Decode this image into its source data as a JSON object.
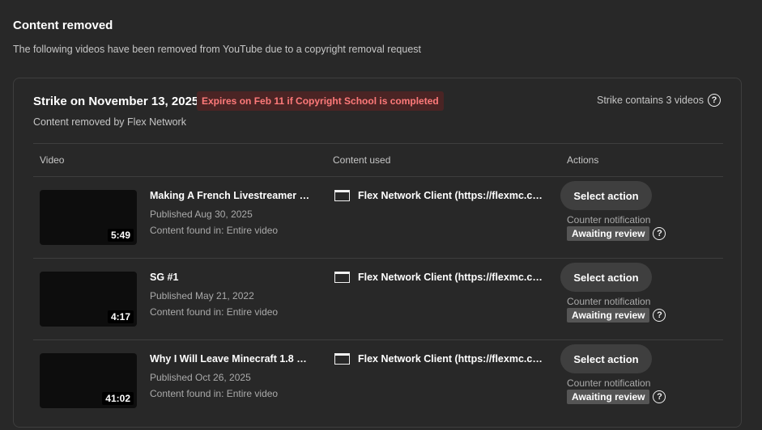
{
  "header": {
    "title": "Content removed",
    "description": "The following videos have been removed from YouTube due to a copyright removal request"
  },
  "strike": {
    "title": "Strike on November 13, 2025",
    "expires_badge": "Expires on Feb 11 if Copyright School is completed",
    "count_text": "Strike contains 3 videos",
    "removed_by": "Content removed by Flex Network"
  },
  "table": {
    "columns": [
      "Video",
      "Content used",
      "Actions"
    ],
    "rows": [
      {
        "title": "Making A French Livestreamer R...",
        "duration": "5:49",
        "published": "Published Aug 30, 2025",
        "found_in": "Content found in: Entire video",
        "content_used": "Flex Network Client (https://flexmc.co...",
        "action_label": "Select action",
        "counter_label": "Counter notification",
        "status": "Awaiting review"
      },
      {
        "title": "SG #1",
        "duration": "4:17",
        "published": "Published May 21, 2022",
        "found_in": "Content found in: Entire video",
        "content_used": "Flex Network Client (https://flexmc.co...",
        "action_label": "Select action",
        "counter_label": "Counter notification",
        "status": "Awaiting review"
      },
      {
        "title": "Why I Will Leave Minecraft 1.8 Be...",
        "duration": "41:02",
        "published": "Published Oct 26, 2025",
        "found_in": "Content found in: Entire video",
        "content_used": "Flex Network Client (https://flexmc.co...",
        "action_label": "Select action",
        "counter_label": "Counter notification",
        "status": "Awaiting review"
      }
    ]
  },
  "icons": {
    "help": "help-circle-icon",
    "content_window": "browser-window-icon"
  },
  "colors": {
    "background": "#282828",
    "expires_badge_bg": "#4a2424",
    "expires_badge_text": "#ff7a7a",
    "status_badge_bg": "#555555",
    "button_bg": "#3f3f3f"
  }
}
